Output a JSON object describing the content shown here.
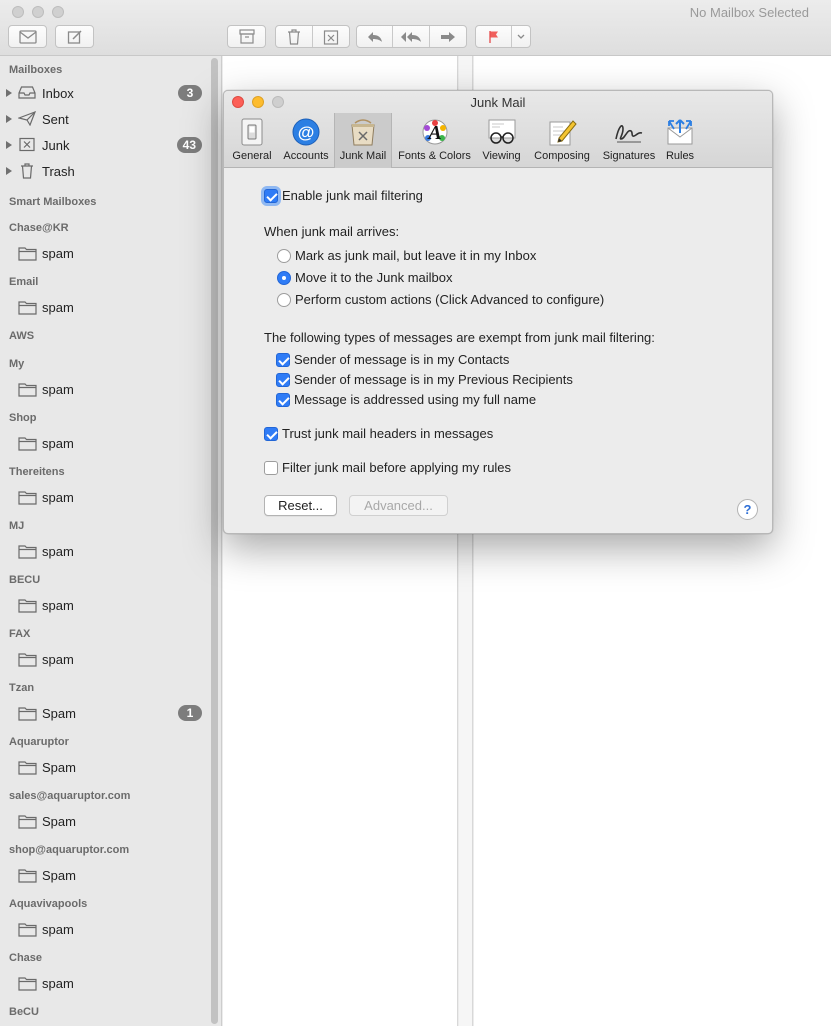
{
  "window": {
    "title": "No Mailbox Selected"
  },
  "sidebar": {
    "mailboxes_header": "Mailboxes",
    "mailboxes": [
      {
        "label": "Inbox",
        "badge": "3",
        "icon": "inbox-tray-icon"
      },
      {
        "label": "Sent",
        "badge": "",
        "icon": "paper-plane-icon"
      },
      {
        "label": "Junk",
        "badge": "43",
        "icon": "junk-box-icon"
      },
      {
        "label": "Trash",
        "badge": "",
        "icon": "trash-can-icon"
      }
    ],
    "smart_header": "Smart Mailboxes",
    "accounts": [
      {
        "name": "Chase@KR",
        "folder": "spam",
        "badge": ""
      },
      {
        "name": "Email",
        "folder": "spam",
        "badge": ""
      },
      {
        "name": "AWS",
        "folder": "",
        "badge": ""
      },
      {
        "name": "My",
        "folder": "spam",
        "badge": ""
      },
      {
        "name": "Shop",
        "folder": "spam",
        "badge": ""
      },
      {
        "name": "Thereitens",
        "folder": "spam",
        "badge": ""
      },
      {
        "name": "MJ",
        "folder": "spam",
        "badge": ""
      },
      {
        "name": "BECU",
        "folder": "spam",
        "badge": ""
      },
      {
        "name": "FAX",
        "folder": "spam",
        "badge": ""
      },
      {
        "name": "Tzan",
        "folder": "Spam",
        "badge": "1"
      },
      {
        "name": "Aquaruptor",
        "folder": "Spam",
        "badge": ""
      },
      {
        "name": "sales@aquaruptor.com",
        "folder": "Spam",
        "badge": ""
      },
      {
        "name": "shop@aquaruptor.com",
        "folder": "Spam",
        "badge": ""
      },
      {
        "name": "Aquavivapools",
        "folder": "spam",
        "badge": ""
      },
      {
        "name": "Chase",
        "folder": "spam",
        "badge": ""
      },
      {
        "name": "BeCU",
        "folder": "",
        "badge": ""
      }
    ]
  },
  "dialog": {
    "title": "Junk Mail",
    "tabs": [
      {
        "label": "General",
        "icon": "light-switch-icon"
      },
      {
        "label": "Accounts",
        "icon": "at-sign-icon"
      },
      {
        "label": "Junk Mail",
        "icon": "junk-mail-bin-icon"
      },
      {
        "label": "Fonts & Colors",
        "icon": "font-palette-icon"
      },
      {
        "label": "Viewing",
        "icon": "glasses-letter-icon"
      },
      {
        "label": "Composing",
        "icon": "pencil-paper-icon"
      },
      {
        "label": "Signatures",
        "icon": "signature-icon"
      },
      {
        "label": "Rules",
        "icon": "rules-envelope-icon"
      }
    ],
    "active_tab": "Junk Mail",
    "enable_filtering": {
      "label": "Enable junk mail filtering",
      "checked": true
    },
    "arrives_header": "When junk mail arrives:",
    "arrive_options": [
      {
        "label": "Mark as junk mail, but leave it in my Inbox",
        "selected": false
      },
      {
        "label": "Move it to the Junk mailbox",
        "selected": true
      },
      {
        "label": "Perform custom actions (Click Advanced to configure)",
        "selected": false
      }
    ],
    "exempt_header": "The following types of messages are exempt from junk mail filtering:",
    "exempt_options": [
      {
        "label": "Sender of message is in my Contacts",
        "checked": true
      },
      {
        "label": "Sender of message is in my Previous Recipients",
        "checked": true
      },
      {
        "label": "Message is addressed using my full name",
        "checked": true
      }
    ],
    "trust_headers": {
      "label": "Trust junk mail headers in messages",
      "checked": true
    },
    "filter_before_rules": {
      "label": "Filter junk mail before applying my rules",
      "checked": false
    },
    "reset_label": "Reset...",
    "advanced_label": "Advanced...",
    "help_label": "?"
  }
}
